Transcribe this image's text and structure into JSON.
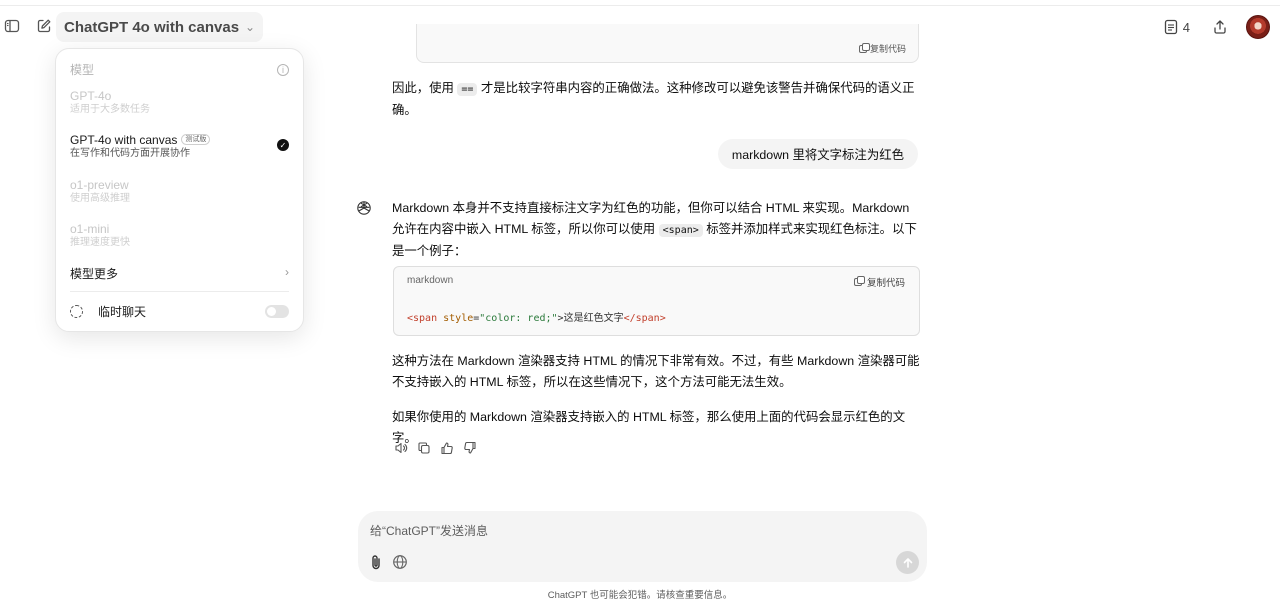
{
  "header": {
    "model_name": "ChatGPT 4o with canvas",
    "doc_count": "4"
  },
  "dropdown": {
    "title": "模型",
    "items": [
      {
        "name": "GPT-4o",
        "desc": "适用于大多数任务",
        "active": false
      },
      {
        "name": "GPT-4o with canvas",
        "badge": "测试版",
        "desc": "在写作和代码方面开展协作",
        "active": true
      },
      {
        "name": "o1-preview",
        "desc": "使用高级推理",
        "active": false
      },
      {
        "name": "o1-mini",
        "desc": "推理速度更快",
        "active": false
      }
    ],
    "more_label": "模型更多",
    "temp_chat_label": "临时聊天",
    "temp_chat_enabled": false
  },
  "conversation": {
    "top_code_copy": "复制代码",
    "prev_answer_pre": "因此，使用",
    "prev_answer_code": "==",
    "prev_answer_post": "才是比较字符串内容的正确做法。这种修改可以避免该警告并确保代码的语义正确。",
    "user_message": "markdown 里将文字标注为红色",
    "answer_p1_pre": "Markdown 本身并不支持直接标注文字为红色的功能，但你可以结合 HTML 来实现。Markdown 允许在内容中嵌入 HTML 标签，所以你可以使用",
    "answer_p1_code": "<span>",
    "answer_p1_post": "标签并添加样式来实现红色标注。以下是一个例子：",
    "code_lang": "markdown",
    "code_copy": "复制代码",
    "code": {
      "open_tag": "<span",
      "attr": " style",
      "eq": "=",
      "value": "\"color: red;\"",
      "close_open": ">",
      "text": "这是红色文字",
      "end_tag": "</span>"
    },
    "answer_p2": "这种方法在 Markdown 渲染器支持 HTML 的情况下非常有效。不过，有些 Markdown 渲染器可能不支持嵌入的 HTML 标签，所以在这些情况下，这个方法可能无法生效。",
    "answer_p3": "如果你使用的 Markdown 渲染器支持嵌入的 HTML 标签，那么使用上面的代码会显示红色的文字。"
  },
  "composer": {
    "placeholder": "给“ChatGPT”发送消息",
    "value": ""
  },
  "footer": {
    "disclaimer": "ChatGPT 也可能会犯错。请核查重要信息。"
  }
}
